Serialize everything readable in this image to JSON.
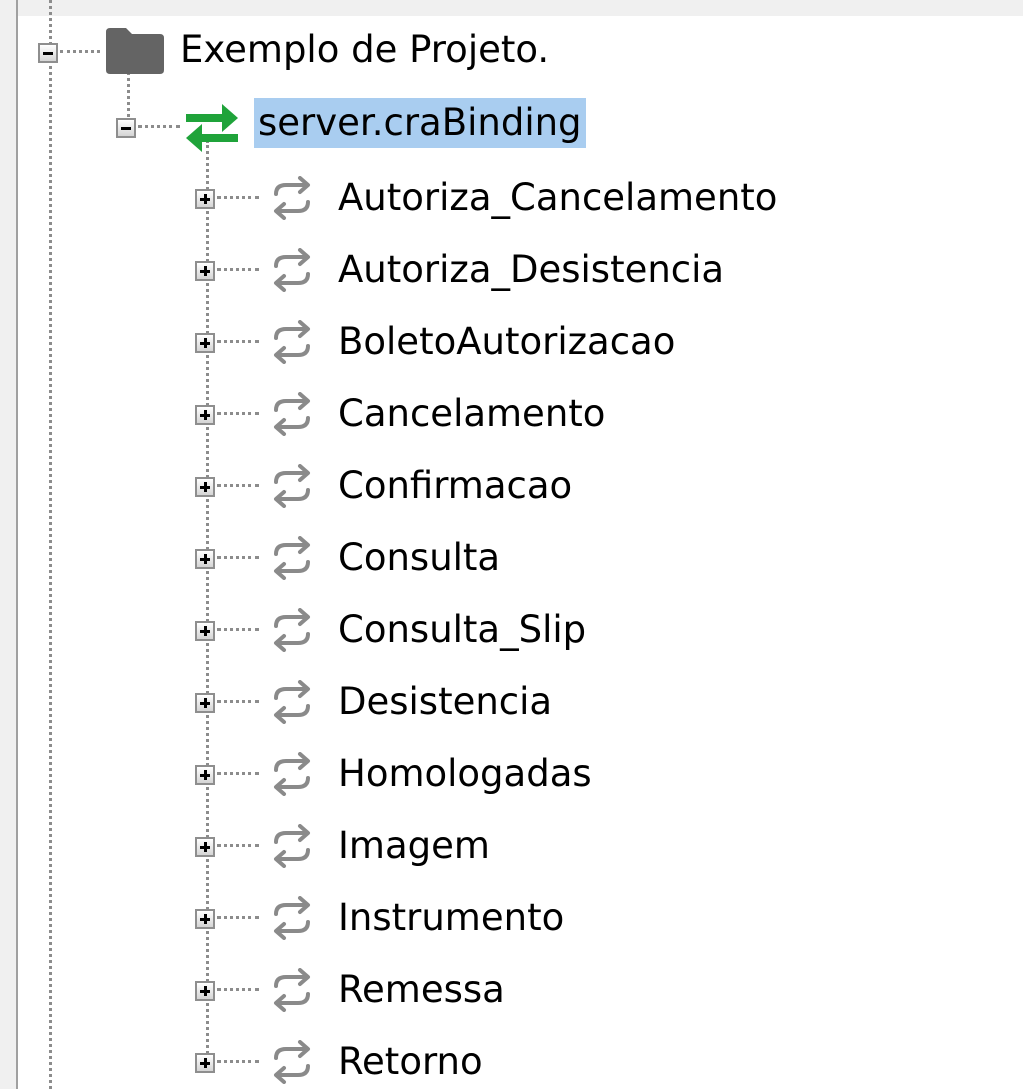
{
  "tree": {
    "root": {
      "label": "Exemplo de Projeto.",
      "icon": "folder-icon",
      "expanded": true
    },
    "binding": {
      "label": "server.craBinding",
      "icon": "binding-arrows-icon",
      "expanded": true,
      "selected": true
    },
    "operations": [
      {
        "label": "Autoriza_Cancelamento"
      },
      {
        "label": "Autoriza_Desistencia"
      },
      {
        "label": "BoletoAutorizacao"
      },
      {
        "label": "Cancelamento"
      },
      {
        "label": "Confirmacao"
      },
      {
        "label": "Consulta"
      },
      {
        "label": "Consulta_Slip"
      },
      {
        "label": "Desistencia"
      },
      {
        "label": "Homologadas"
      },
      {
        "label": "Imagem"
      },
      {
        "label": "Instrumento"
      },
      {
        "label": "Remessa"
      },
      {
        "label": "Retorno"
      }
    ]
  },
  "colors": {
    "selection": "#a9cdf0",
    "binding_arrows": "#1fa33a",
    "operation_icon": "#8a8a8a",
    "folder": "#646464"
  }
}
